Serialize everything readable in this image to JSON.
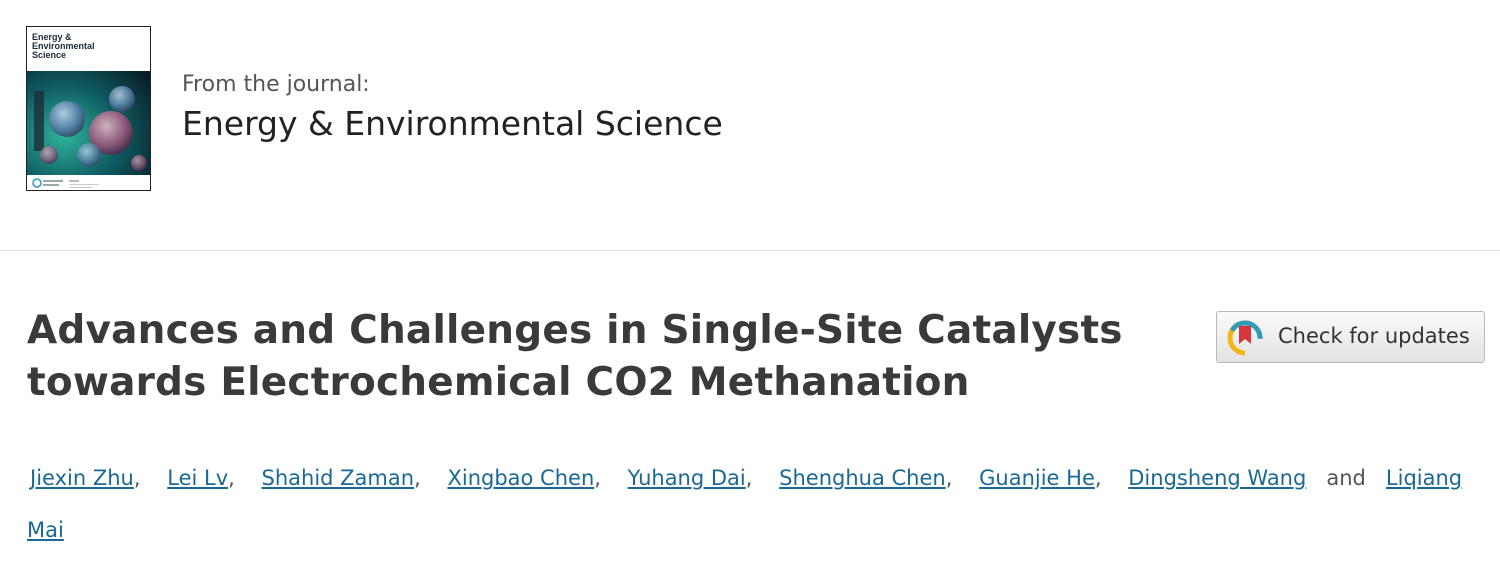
{
  "journal": {
    "cover_title": "Energy & Environmental Science",
    "from_label": "From the journal:",
    "name": "Energy & Environmental Science"
  },
  "article": {
    "title_line1": "Advances and Challenges in Single-Site Catalysts",
    "title_line2": "towards Electrochemical CO2 Methanation"
  },
  "crossmark": {
    "label": "Check for updates",
    "icon": "crossmark-icon",
    "colors": {
      "red": "#d6353a",
      "yellow": "#f4b414",
      "teal": "#2f9bb8"
    }
  },
  "authors": {
    "list": [
      "Jiexin Zhu",
      "Lei Lv",
      "Shahid Zaman",
      "Xingbao Chen",
      "Yuhang Dai",
      "Shenghua Chen",
      "Guanjie He",
      "Dingsheng Wang",
      "Liqiang Mai"
    ],
    "separator": ",",
    "conjunction": "and"
  },
  "colors": {
    "link": "#1a6896",
    "title": "#3a3a3a",
    "divider": "#e3e3e3"
  }
}
